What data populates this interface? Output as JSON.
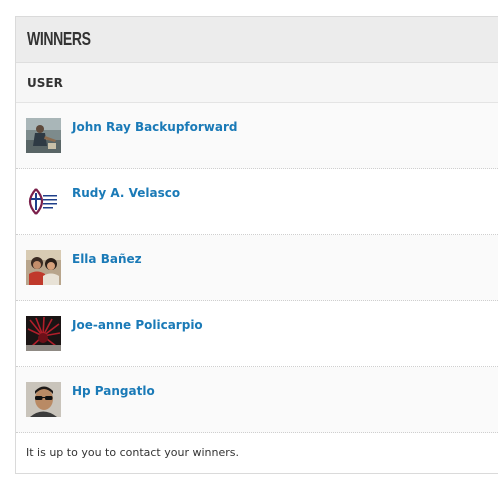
{
  "panel": {
    "title": "WINNERS",
    "column_header": "USER",
    "footer_note": "It is up to you to contact your winners."
  },
  "winners": [
    {
      "name": "John Ray Backupforward",
      "avatar": "man-by-water-photo"
    },
    {
      "name": "Rudy A. Velasco",
      "avatar": "fish-cross-logo"
    },
    {
      "name": "Ella Bañez",
      "avatar": "two-people-photo"
    },
    {
      "name": "Joe-anne Policarpio",
      "avatar": "red-spiky-object-photo"
    },
    {
      "name": "Hp Pangatlo",
      "avatar": "man-with-sunglasses-photo"
    }
  ],
  "colors": {
    "link": "#1a7ab7",
    "header_bg": "#ececec",
    "text": "#333333"
  }
}
